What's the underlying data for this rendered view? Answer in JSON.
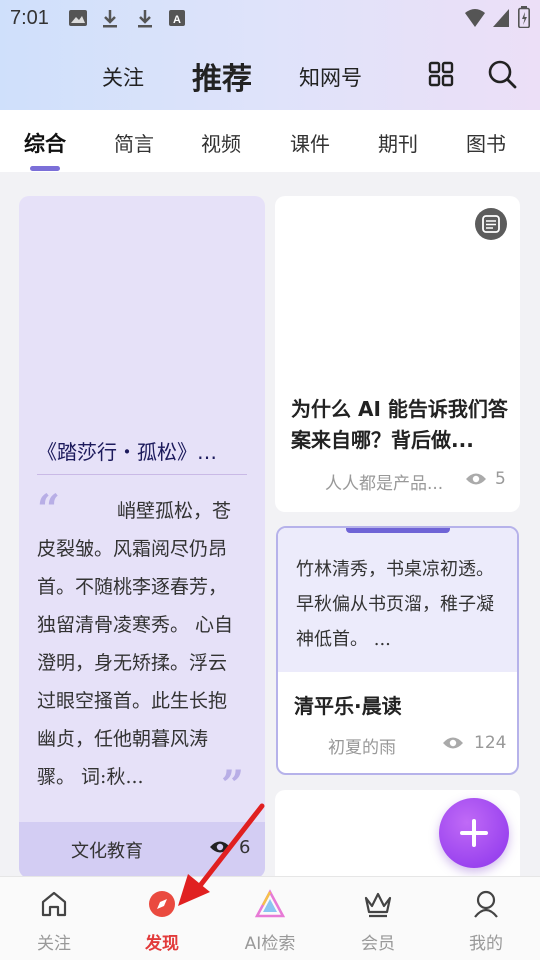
{
  "status_bar": {
    "time": "7:01"
  },
  "header": {
    "tabs": [
      {
        "label": "关注"
      },
      {
        "label": "推荐"
      },
      {
        "label": "知网号"
      }
    ],
    "active_tab": "推荐"
  },
  "categories": {
    "tabs": [
      "综合",
      "简言",
      "视频",
      "课件",
      "期刊",
      "图书"
    ],
    "active": "综合",
    "accent_color": "#7b6fd8"
  },
  "feed": {
    "left_card": {
      "title": "《踏莎行・孤松》…",
      "body": "峭壁孤松，苍皮裂皱。风霜阅尽仍昂首。不随桃李逐春芳，独留清骨凌寒秀。 心自澄明，身无矫揉。浮云过眼空搔首。此生长抱幽贞，任他朝暮风涛骤。 词:秋...",
      "quote_open": "“",
      "quote_close": "”",
      "category": "文化教育",
      "views": "6"
    },
    "right_card_1": {
      "title": "为什么 AI 能告诉我们答案来自哪？背后做...",
      "source": "人人都是产品...",
      "views": "5",
      "badge_icon": "document-icon"
    },
    "right_card_2": {
      "quote": "竹林清秀，书桌凉初透。 早秋偏从书页溜，稚子凝神低首。 ...",
      "title": "清平乐·晨读",
      "author": "初夏的雨",
      "views": "124"
    }
  },
  "bottom_nav": {
    "items": [
      {
        "label": "关注",
        "icon": "home-icon"
      },
      {
        "label": "发现",
        "icon": "compass-icon"
      },
      {
        "label": "AI检索",
        "icon": "ai-triangle-icon"
      },
      {
        "label": "会员",
        "icon": "crown-icon"
      },
      {
        "label": "我的",
        "icon": "person-icon"
      }
    ],
    "active": "发现",
    "active_color": "#e23b3b"
  }
}
